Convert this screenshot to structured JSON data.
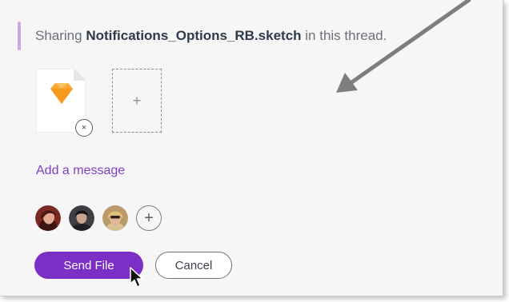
{
  "share": {
    "prefix": "Sharing ",
    "file_name": "Notifications_Options_RB.sketch",
    "suffix": " in this thread."
  },
  "attachments": {
    "file_icon": "sketch-file-icon",
    "remove_symbol": "×",
    "add_symbol": "+"
  },
  "message": {
    "add_message_label": "Add a message"
  },
  "recipients": {
    "avatars": [
      "avatar-1",
      "avatar-2",
      "avatar-3"
    ],
    "add_symbol": "+"
  },
  "actions": {
    "send_label": "Send File",
    "cancel_label": "Cancel"
  },
  "colors": {
    "accent": "#7b2fc6",
    "link": "#7f3fc6",
    "sketch_orange": "#f7a933",
    "annotation_arrow": "#7e7e7e"
  }
}
